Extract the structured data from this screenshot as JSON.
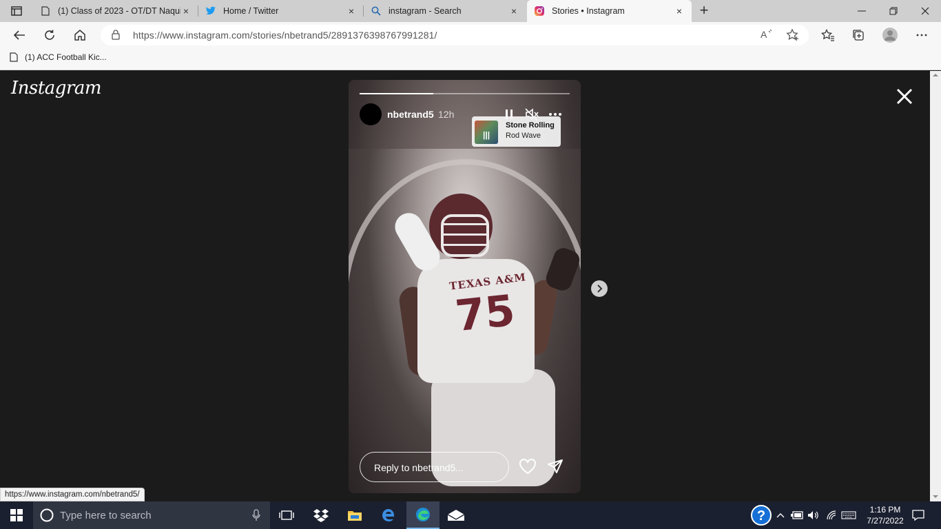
{
  "browser": {
    "tabs": [
      {
        "title": "(1) Class of 2023 - OT/DT Naquil",
        "icon": "document-icon",
        "close": "×"
      },
      {
        "title": "Home / Twitter",
        "icon": "twitter-icon",
        "close": "×"
      },
      {
        "title": "instagram - Search",
        "icon": "search-icon",
        "close": "×"
      },
      {
        "title": "Stories • Instagram",
        "icon": "instagram-icon",
        "close": "×",
        "active": true
      }
    ],
    "new_tab": "+",
    "address": "https://www.instagram.com/stories/nbetrand5/2891376398767991281/",
    "bookmarks": [
      {
        "label": "(1) ACC Football Kic..."
      }
    ],
    "status_url": "https://www.instagram.com/nbetrand5/"
  },
  "instagram": {
    "logo": "Instagram",
    "story": {
      "username": "nbetrand5",
      "time_ago": "12h",
      "progress": 0.35,
      "music": {
        "song": "Stone Rolling",
        "artist": "Rod Wave"
      },
      "jersey_text": "TEXAS A&M",
      "jersey_number": "75",
      "reply_placeholder": "Reply to nbetrand5..."
    }
  },
  "taskbar": {
    "search_placeholder": "Type here to search",
    "time": "1:16 PM",
    "date": "7/27/2022"
  },
  "colors": {
    "background": "#1b1b1b",
    "maroon": "#6c2630",
    "taskbar": "#1b2030",
    "accent": "#76b9ed"
  }
}
